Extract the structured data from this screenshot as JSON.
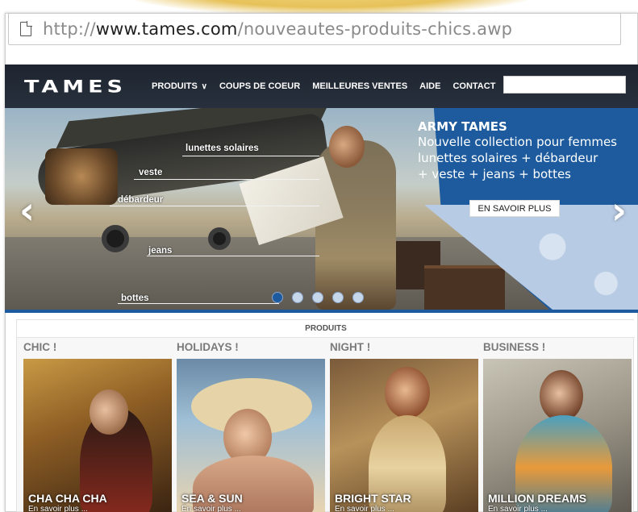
{
  "browser": {
    "url_scheme": "http://",
    "url_domain": "www.tames.com",
    "url_path": "/nouveautes-produits-chics.awp"
  },
  "site": {
    "logo": "TAMES",
    "nav": [
      "PRODUITS",
      "COUPS DE COEUR",
      "MEILLEURES VENTES",
      "AIDE",
      "CONTACT"
    ],
    "search_placeholder": ""
  },
  "hero": {
    "title": "ARMY TAMES",
    "lines": [
      "Nouvelle collection pour femmes",
      "lunettes solaires + débardeur",
      "+ veste + jeans + bottes"
    ],
    "cta": "EN SAVOIR PLUS",
    "labels": [
      "lunettes solaires",
      "veste",
      "débardeur",
      "jeans",
      "bottes"
    ],
    "slide_count": 5,
    "active_slide": 1,
    "accent_color": "#1d5b9e"
  },
  "products": {
    "header": "PRODUITS",
    "categories": [
      {
        "title": "CHIC !",
        "name": "CHA CHA CHA",
        "sub": "En savoir plus ..."
      },
      {
        "title": "HOLIDAYS !",
        "name": "SEA & SUN",
        "sub": "En savoir plus ..."
      },
      {
        "title": "NIGHT !",
        "name": "BRIGHT STAR",
        "sub": "En savoir plus ..."
      },
      {
        "title": "BUSINESS !",
        "name": "MILLION DREAMS",
        "sub": "En savoir plus ..."
      }
    ]
  }
}
